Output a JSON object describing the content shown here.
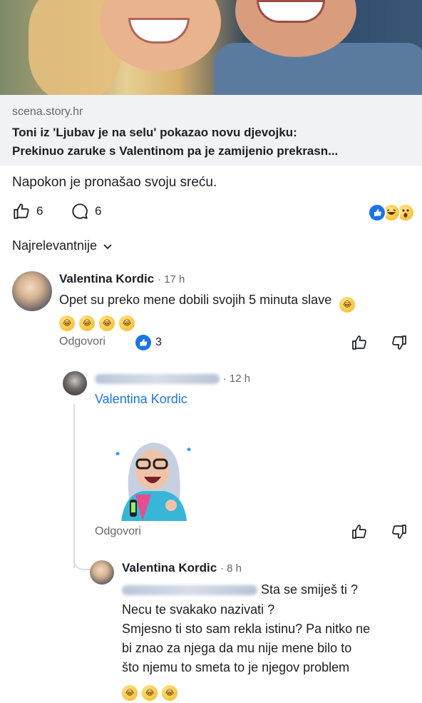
{
  "post": {
    "link": {
      "domain": "scena.story.hr",
      "title_line1": "Toni iz 'Ljubav je na selu' pokazao novu djevojku:",
      "title_line2": "Prekinuo zaruke s Valentinom pa je zamijenio prekrasn..."
    },
    "caption": "Napokon je pronašao svoju sreću.",
    "likes_count": "6",
    "comments_count": "6",
    "reactions": [
      "like-icon",
      "laugh-icon",
      "wow-icon"
    ]
  },
  "sort": {
    "label": "Najrelevantnije"
  },
  "comments": [
    {
      "author": "Valentina Kordic",
      "time": "· 17 h",
      "line1": "Opet su preko mene dobili svojih 5 minuta slave",
      "reply_label": "Odgovori",
      "like_count": "3"
    },
    {
      "time": "· 12 h",
      "mention": "Valentina Kordic",
      "reply_label": "Odgovori"
    },
    {
      "author": "Valentina Kordic",
      "time": "· 8 h",
      "line1": "Sta se smiješ ti ?",
      "line2": "Necu te svakako nazivati ?",
      "line3": "Smjesno ti sto sam rekla istinu? Pa nitko ne",
      "line4": "bi znao za njega da mu nije mene bilo to",
      "line5": "što njemu to smeta to je njegov problem"
    }
  ],
  "colors": {
    "accent": "#1b74e4",
    "muted": "#65676b",
    "link_bg": "#f0f2f5"
  }
}
